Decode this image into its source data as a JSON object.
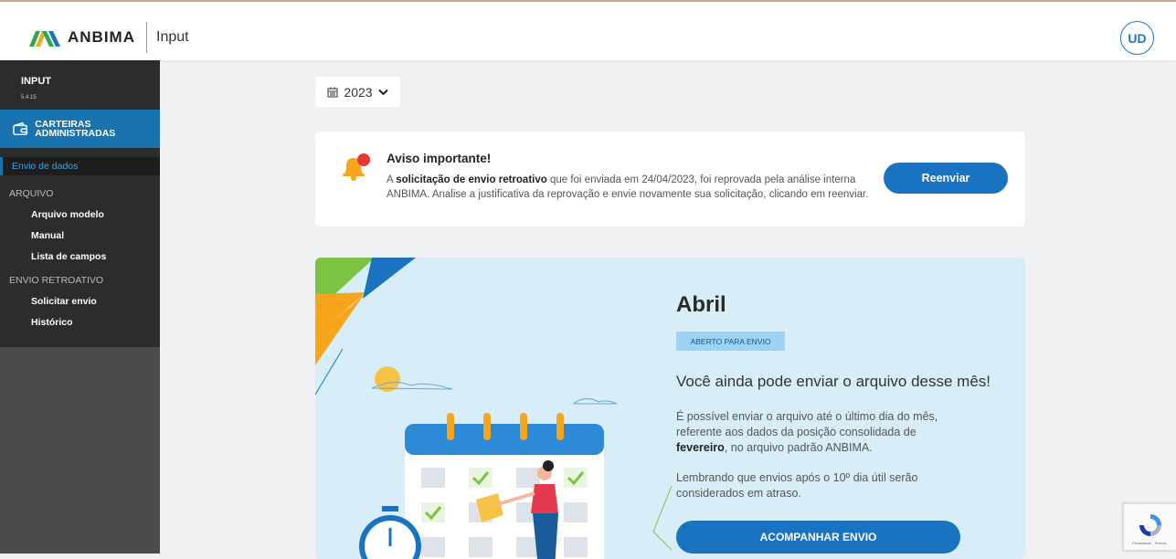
{
  "header": {
    "brand": "ANBIMA",
    "app_name": "Input",
    "avatar_initials": "UD",
    "brand_colors": [
      "#2ea84a",
      "#f7a51c",
      "#1a73c0"
    ]
  },
  "sidebar": {
    "app_title": "INPUT",
    "version": "5.4.15",
    "section_title": "CARTEIRAS ADMINISTRADAS",
    "section_icon": "wallet-icon",
    "active_item": "Envio de dados",
    "groups": [
      {
        "title": "ARQUIVO",
        "items": [
          "Arquivo modelo",
          "Manual",
          "Lista de campos"
        ]
      },
      {
        "title": "ENVIO RETROATIVO",
        "items": [
          "Solicitar envio",
          "Histórico"
        ]
      }
    ]
  },
  "year_selector": {
    "icon": "calendar-icon",
    "value": "2023",
    "chevron": "chevron-down-icon"
  },
  "notice": {
    "icon": "bell-icon",
    "title": "Aviso importante!",
    "text_prefix": "A ",
    "text_bold": "solicitação de envio retroativo",
    "text_rest": " que foi enviada em 24/04/2023, foi reprovada pela análise interna ANBIMA. Analise a justificativa da reprovação e envie novamente sua solicitação, clicando em reenviar.",
    "button_label": "Reenviar"
  },
  "month_card": {
    "month": "Abril",
    "status_badge": "ABERTO PARA ENVIO",
    "headline": "Você ainda pode enviar o arquivo desse mês!",
    "description_prefix": "É possível enviar o arquivo até o último dia do mês, referente aos dados da posição consolidada de ",
    "description_bold": "fevereiro",
    "description_suffix": ", no arquivo padrão ANBIMA.",
    "note": "Lembrando que envios após o 10º dia útil serão considerados em atraso.",
    "button_label": "ACOMPANHAR ENVIO"
  },
  "recaptcha": {
    "footer": "Privacidade - Termos"
  },
  "colors": {
    "primary": "#1a73c0",
    "sidebar_bg": "#2c2c2c",
    "card_bg": "#d7eef9"
  }
}
